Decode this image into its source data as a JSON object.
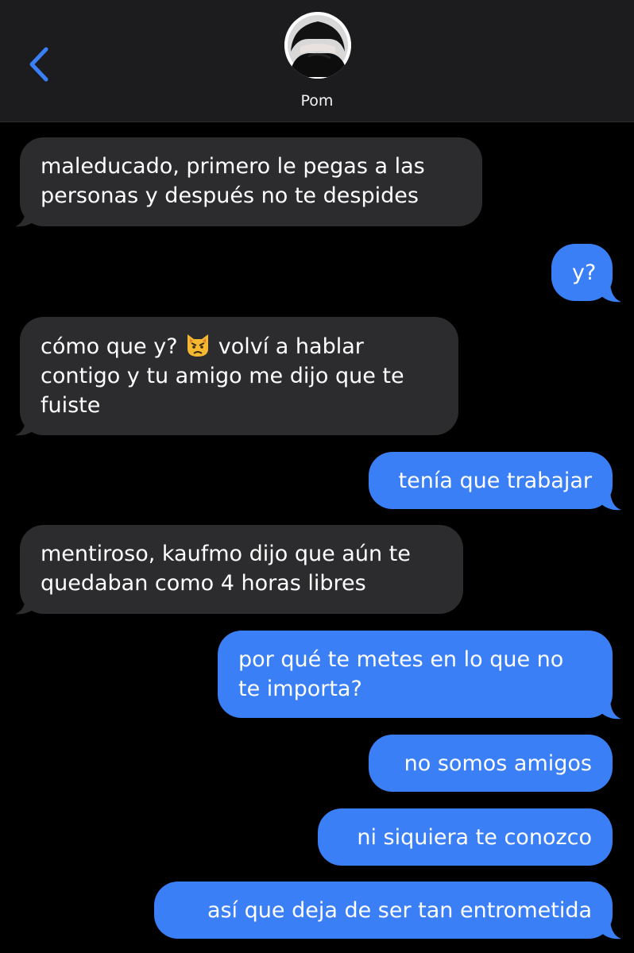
{
  "header": {
    "back_icon": "chevron-left-icon",
    "contact_name": "Pom",
    "accent_color": "#3a7ff6"
  },
  "messages": [
    {
      "direction": "incoming",
      "lines": [
        "maleducado, primero le pegas a las",
        "personas y después no te despides"
      ]
    },
    {
      "direction": "outgoing",
      "lines": [
        "y?"
      ]
    },
    {
      "direction": "incoming",
      "lines": [
        "cómo que y?",
        "volví a hablar",
        "contigo y tu amigo me dijo que te",
        "fuiste"
      ],
      "emoji": "pouting-cat-emoji"
    },
    {
      "direction": "outgoing",
      "lines": [
        "tenía que trabajar"
      ]
    },
    {
      "direction": "incoming",
      "lines": [
        "mentiroso, kaufmo dijo que aún te",
        "quedaban como 4 horas libres"
      ]
    },
    {
      "direction": "outgoing",
      "lines": [
        "por qué te metes en lo que no",
        "te importa?"
      ]
    },
    {
      "direction": "outgoing",
      "lines": [
        "no somos amigos"
      ]
    },
    {
      "direction": "outgoing",
      "lines": [
        "ni siquiera te conozco"
      ]
    },
    {
      "direction": "outgoing",
      "lines": [
        "así que deja de ser tan entrometida"
      ]
    }
  ],
  "colors": {
    "incoming_bubble": "#2c2c2e",
    "outgoing_bubble": "#3a7ff6",
    "background": "#000000",
    "header_bg": "#1c1c1e"
  }
}
